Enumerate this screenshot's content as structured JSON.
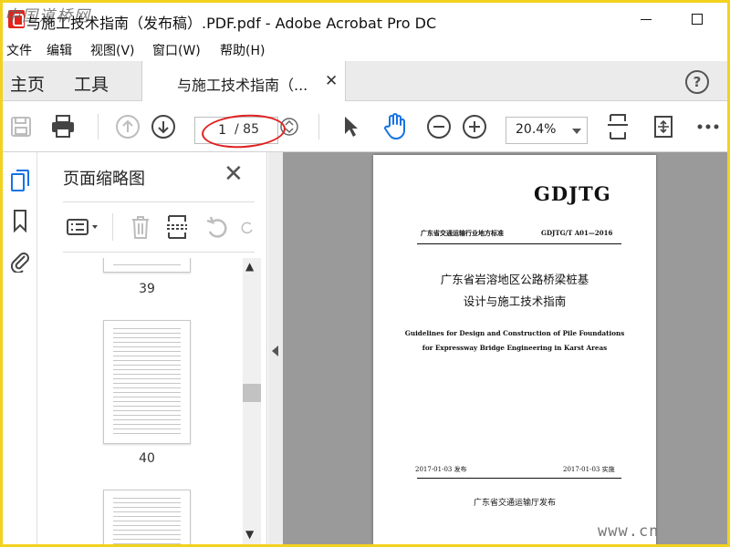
{
  "window": {
    "title": "与施工技术指南（发布稿）.PDF.pdf - Adobe Acrobat Pro DC",
    "watermark_top": "中国道桥网",
    "watermark_bottom": "www.cn"
  },
  "menu": [
    "文件",
    "编辑",
    "视图(V)",
    "窗口(W)",
    "帮助(H)"
  ],
  "tabs": {
    "home": "主页",
    "tools": "工具",
    "document": "与施工技术指南（...",
    "help": "?"
  },
  "toolbar": {
    "page_current": "1",
    "page_total": "/ 85",
    "zoom": "20.4%",
    "icons": [
      "save-icon",
      "print-icon",
      "prev-page-icon",
      "next-page-icon",
      "select-cursor-icon",
      "hand-icon",
      "zoom-out-icon",
      "zoom-in-icon",
      "fit-page-icon",
      "rotate-view-icon",
      "more-icon"
    ]
  },
  "sidebar": {
    "rail_icons": [
      "page-thumbnails-icon",
      "bookmark-icon",
      "attachment-icon"
    ],
    "panel_title": "页面缩略图",
    "panel_close": "✕",
    "tools": [
      "thumbnail-options-icon",
      "delete-icon",
      "insert-page-icon",
      "rotate-counter-icon",
      "rotate-clockwise-icon"
    ],
    "thumbnails": [
      {
        "page": "39"
      },
      {
        "page": "40"
      },
      {
        "page": ""
      }
    ]
  },
  "document": {
    "code": "GDJTG",
    "category": "广东省交通运输行业地方标准",
    "number": "GDJTG/T A01—2016",
    "title_line1": "广东省岩溶地区公路桥梁桩基",
    "title_line2": "设计与施工技术指南",
    "english_line1": "Guidelines for Design and Construction of Pile Foundations",
    "english_line2": "for Expressway Bridge Engineering in Karst Areas",
    "issue_date": "2017-01-03 发布",
    "implement_date": "2017-01-03 实施",
    "publisher": "广东省交通运输厅发布"
  },
  "colors": {
    "frame": "#f2d21e",
    "accent_blue": "#1473e6",
    "annotation_red": "#e02020",
    "canvas_gray": "#9a9a9a"
  }
}
